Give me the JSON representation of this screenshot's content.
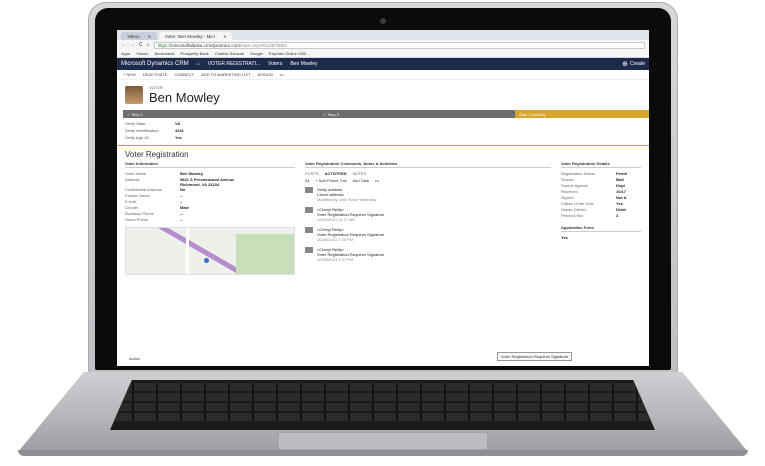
{
  "browser": {
    "tabs": [
      {
        "label": "Yahoo"
      },
      {
        "label": "Voter: Ben Mowley - Micr"
      }
    ],
    "url_secure": "https://",
    "url_host": "microsoftalaska.crmdynamics.com",
    "url_path": "/main.aspx#512873852",
    "bookmarks": [
      "Apps",
      "Yahoo!",
      "Bookmarks",
      "Prosperity Bank",
      "Charles Schwab",
      "Google",
      "Paychex Online USE..."
    ]
  },
  "crmnav": {
    "brand": "Microsoft Dynamics CRM",
    "area": "VOTER REGISTRATI...",
    "entity": "Voters",
    "record": "Ben Mowley",
    "create": "Create"
  },
  "commands": [
    "+ NEW",
    "DEACTIVATE",
    "CONNECT",
    "ADD TO MARKETING LIST",
    "ASSIGN",
    "•••"
  ],
  "record": {
    "entity_label": "VOTER",
    "name": "Ben Mowley"
  },
  "process": {
    "stages": [
      {
        "label": "✓ Step 1"
      },
      {
        "label": "✓ Step 2"
      },
      {
        "label": "Step 3 (Active)"
      }
    ],
    "checks": [
      {
        "label": "Verify State",
        "value": "VA"
      },
      {
        "label": "Verify Identification",
        "value": "4321"
      },
      {
        "label": "Verify Age 18",
        "value": "Yes"
      }
    ]
  },
  "section_title": "Voter Registration",
  "voter_info": {
    "heading": "Voter Information",
    "fields": [
      {
        "label": "Voter Name",
        "value": "Ben Mowley"
      },
      {
        "label": "Address",
        "value": "5841 S Prestonwood Avenue Richmond, VA 23234"
      },
      {
        "label": "Confidential Address",
        "value": "No"
      },
      {
        "label": "Former Name",
        "value": "--"
      },
      {
        "label": "E-mail",
        "value": "--"
      },
      {
        "label": "Gender",
        "value": "Male"
      },
      {
        "label": "Business Phone",
        "value": "--"
      },
      {
        "label": "Home Phone",
        "value": "--"
      }
    ]
  },
  "activities": {
    "heading": "Voter Registration Comments, Notes & Activities",
    "tabs": [
      "POSTS",
      "ACTIVITIES",
      "NOTES"
    ],
    "actions": [
      "All",
      "+ Add Phone Call",
      "Add Task",
      "•••"
    ],
    "items": [
      {
        "title": "Verify address",
        "sub": "Check address",
        "meta": "Modified by John Rose  Yesterday"
      },
      {
        "title": "<Cheryl Reilly>",
        "sub": "Voter Registration Requires Signature",
        "meta": "12/31/2013 11:17 AM"
      },
      {
        "title": "<Cheryl Reilly>",
        "sub": "Voter Registration Requires Signature",
        "meta": "10/28/2013 7:33 PM"
      },
      {
        "title": "<Cheryl Reilly>",
        "sub": "Voter Registration Requires Signature",
        "meta": "10/28/2013 1:37 PM"
      }
    ]
  },
  "reg_details": {
    "heading": "Voter Registration Details",
    "fields": [
      {
        "label": "Registration Status",
        "value": "Pendi"
      },
      {
        "label": "Source",
        "value": "Mail"
      },
      {
        "label": "Source Agency",
        "value": "Dept"
      },
      {
        "label": "Received",
        "value": "10/17"
      },
      {
        "label": "Signed",
        "value": "Not A"
      },
      {
        "label": "Citizen of the USA",
        "value": "Yes"
      },
      {
        "label": "House District",
        "value": "Distri"
      },
      {
        "label": "Precinct Nbr",
        "value": "3"
      }
    ],
    "form_heading": "Application Form",
    "form_value": "Yes"
  },
  "tooltip": "Voter Registration Requires Signature",
  "status": "Active"
}
